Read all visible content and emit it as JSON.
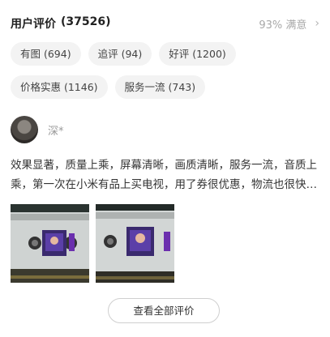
{
  "header": {
    "title": "用户评价",
    "count": "(37526)",
    "satisfaction": "93% 满意",
    "chevron": "›"
  },
  "tags": [
    "有图 (694)",
    "追评 (94)",
    "好评 (1200)",
    "价格实惠 (1146)",
    "服务一流 (743)"
  ],
  "review": {
    "user": "深*",
    "text": "效果显著，质量上乘，屏幕清晰，画质清晰，服务一流，音质上乘，第一次在小米有品上买电视，用了券很优惠，物流也很快，非常满意"
  },
  "more_button": "查看全部评价",
  "icons": {
    "chevron": "chevron-right-icon"
  }
}
